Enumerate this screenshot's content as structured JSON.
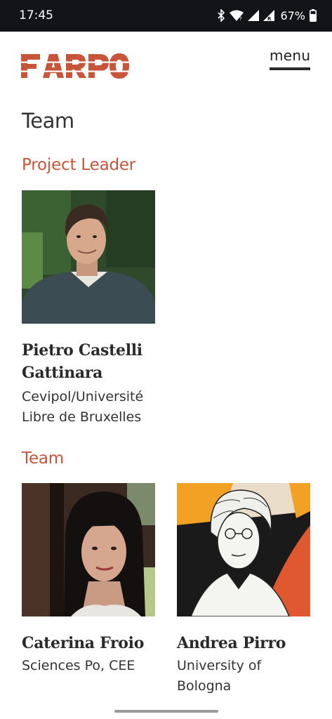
{
  "status_bar": {
    "time": "17:45",
    "battery": "67%",
    "icons": [
      "bluetooth-icon",
      "wifi-icon",
      "signal-icon",
      "signal-roaming-icon",
      "battery-icon"
    ]
  },
  "header": {
    "logo_text": "FARPO",
    "menu_label": "menu"
  },
  "colors": {
    "accent": "#c8553a",
    "text": "#2b2b2b",
    "status_bar": "#121417"
  },
  "page": {
    "title": "Team"
  },
  "sections": [
    {
      "heading": "Project Leader",
      "members": [
        {
          "name_line1": "Pietro Castelli",
          "name_line2": "Gattinara",
          "aff_line1": "Cevipol/Université",
          "aff_line2": "Libre de Bruxelles"
        }
      ]
    },
    {
      "heading": "Team",
      "members": [
        {
          "name_line1": "Caterina Froio",
          "aff_line1": "Sciences Po, CEE"
        },
        {
          "name_line1": "Andrea Pirro",
          "aff_line1": "University of",
          "aff_line2": "Bologna"
        }
      ]
    }
  ]
}
